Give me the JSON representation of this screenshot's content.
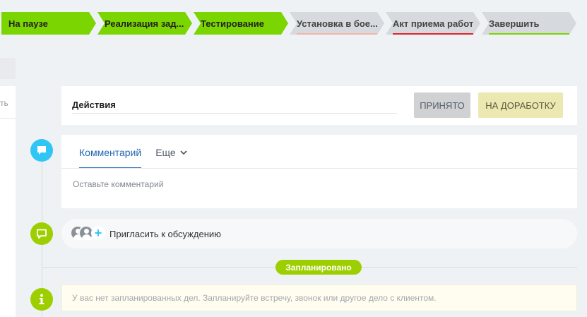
{
  "stages": [
    {
      "label": "На паузе",
      "state": "done",
      "width": 134,
      "bar_color": ""
    },
    {
      "label": "Реализация зад...",
      "state": "done",
      "width": 134,
      "bar_color": ""
    },
    {
      "label": "Тестирование",
      "state": "done",
      "width": 134,
      "bar_color": ""
    },
    {
      "label": "Установка в бое...",
      "state": "todo",
      "width": 134,
      "bar_color": "#f1b5a6"
    },
    {
      "label": "Акт приема работ",
      "state": "todo",
      "width": 134,
      "bar_color": "#e0242d"
    },
    {
      "label": "Завершить",
      "state": "todo",
      "width": 134,
      "bar_color": "#7bd500"
    }
  ],
  "left_stub": {
    "text": "ть"
  },
  "actions": {
    "title": "Действия",
    "accept_label": "Принято",
    "rework_label": "На доработку"
  },
  "comment": {
    "tab_comment": "Комментарий",
    "tab_more": "Еще",
    "placeholder": "Оставьте комментарий"
  },
  "invite": {
    "label": "Пригласить к обсуждению"
  },
  "planned": {
    "badge": "Запланировано"
  },
  "empty_state": {
    "text": "У вас нет запланированных дел. Запланируйте встречу, звонок или другое дело с клиентом."
  },
  "colors": {
    "stage_done": "#7bd500",
    "stage_todo": "#d6d9dd",
    "accent_blue": "#2fc6f6",
    "accent_green": "#9dcf00"
  }
}
